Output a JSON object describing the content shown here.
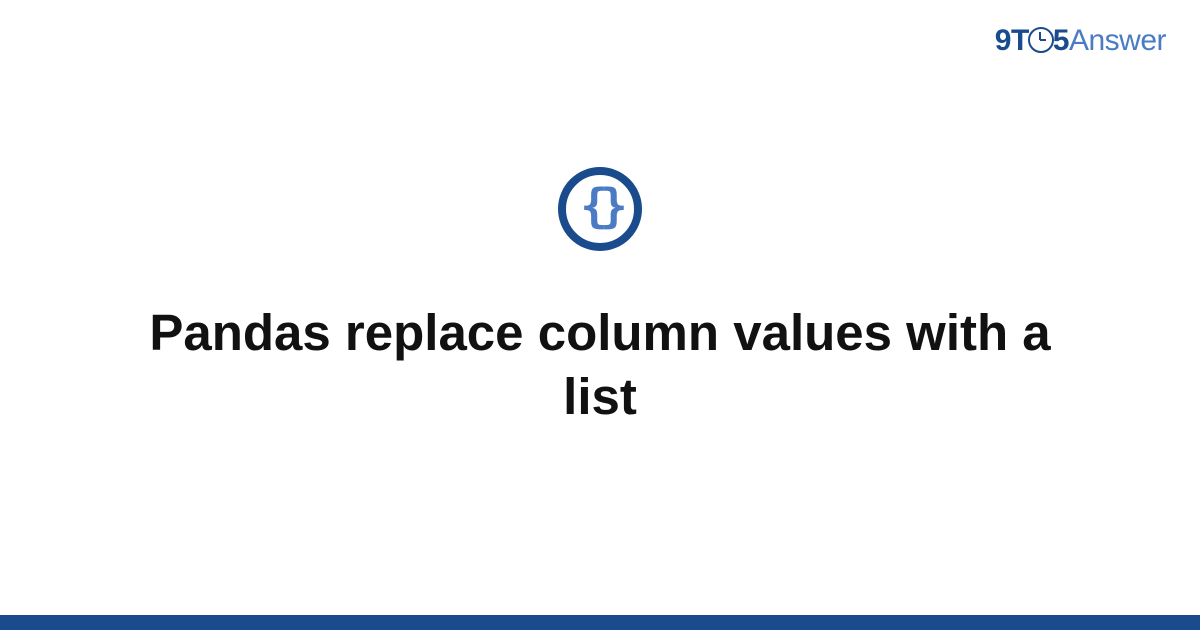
{
  "brand": {
    "nine": "9",
    "t": "T",
    "five": "5",
    "answer": "Answer"
  },
  "icon": {
    "name": "code-braces-icon",
    "glyph": "{}"
  },
  "title": "Pandas replace column values with a list",
  "colors": {
    "primary": "#1a4b8c",
    "secondary": "#4a7bc4",
    "text": "#111111"
  }
}
